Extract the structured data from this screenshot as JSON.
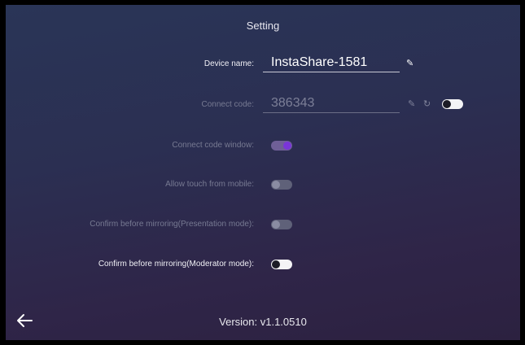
{
  "title": "Setting",
  "device_name": {
    "label": "Device name:",
    "value": "InstaShare-1581",
    "edit_icon": "pencil-icon"
  },
  "connect_code": {
    "label": "Connect code:",
    "value": "386343",
    "edit_icon": "pencil-icon",
    "refresh_icon": "refresh-icon",
    "toggle_on": false,
    "enabled": false
  },
  "settings": [
    {
      "label": "Connect code window:",
      "on": true,
      "enabled": false
    },
    {
      "label": "Allow touch from mobile:",
      "on": false,
      "enabled": false
    },
    {
      "label": "Confirm before mirroring(Presentation mode):",
      "on": false,
      "enabled": false
    },
    {
      "label": "Confirm before mirroring(Moderator mode):",
      "on": false,
      "enabled": true
    }
  ],
  "version": "Version: v1.1.0510",
  "back_icon": "back-arrow-icon",
  "colors": {
    "accent": "#7a35d9",
    "background_top": "#2a3557",
    "background_bottom": "#2c2140"
  }
}
